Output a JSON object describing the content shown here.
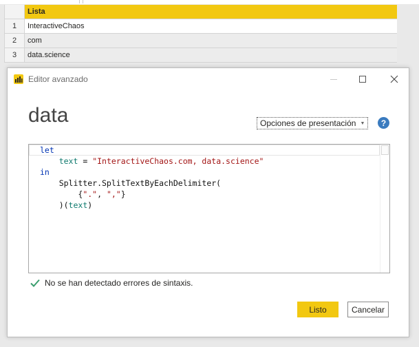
{
  "grid": {
    "header": "Lista",
    "rows": [
      {
        "num": "1",
        "value": "InteractiveChaos"
      },
      {
        "num": "2",
        "value": "com"
      },
      {
        "num": "3",
        "value": "data.science"
      }
    ]
  },
  "dialog": {
    "title": "Editor avanzado",
    "query_name": "data",
    "display_options_label": "Opciones de presentación",
    "help_glyph": "?",
    "editor": {
      "lines": [
        {
          "tokens": [
            {
              "t": "let",
              "c": "kw"
            }
          ]
        },
        {
          "tokens": [
            {
              "t": "    ",
              "c": "plain"
            },
            {
              "t": "text",
              "c": "id"
            },
            {
              "t": " = ",
              "c": "plain"
            },
            {
              "t": "\"InteractiveChaos.com, data.science\"",
              "c": "str"
            }
          ]
        },
        {
          "tokens": [
            {
              "t": "in",
              "c": "kw"
            }
          ]
        },
        {
          "tokens": [
            {
              "t": "    Splitter.SplitTextByEachDelimiter(",
              "c": "plain"
            }
          ]
        },
        {
          "tokens": [
            {
              "t": "        {",
              "c": "plain"
            },
            {
              "t": "\".\"",
              "c": "str"
            },
            {
              "t": ", ",
              "c": "plain"
            },
            {
              "t": "\",\"",
              "c": "str"
            },
            {
              "t": "}",
              "c": "plain"
            }
          ]
        },
        {
          "tokens": [
            {
              "t": "    )(",
              "c": "plain"
            },
            {
              "t": "text",
              "c": "id"
            },
            {
              "t": ")",
              "c": "plain"
            }
          ]
        }
      ]
    },
    "syntax_status": "No se han detectado errores de sintaxis.",
    "ok_label": "Listo",
    "cancel_label": "Cancelar",
    "icons": {
      "app": "powerbi-icon",
      "minimize": "minimize-icon",
      "maximize": "maximize-icon",
      "close": "close-icon",
      "check": "check-icon",
      "help": "help-icon",
      "dropdown": "chevron-down-icon"
    },
    "colors": {
      "accent": "#f2c811",
      "check": "#3a9e6e",
      "help": "#3a7bbf",
      "keyword": "#0033b3",
      "identifier": "#0f7a6e",
      "string": "#a31515"
    }
  }
}
